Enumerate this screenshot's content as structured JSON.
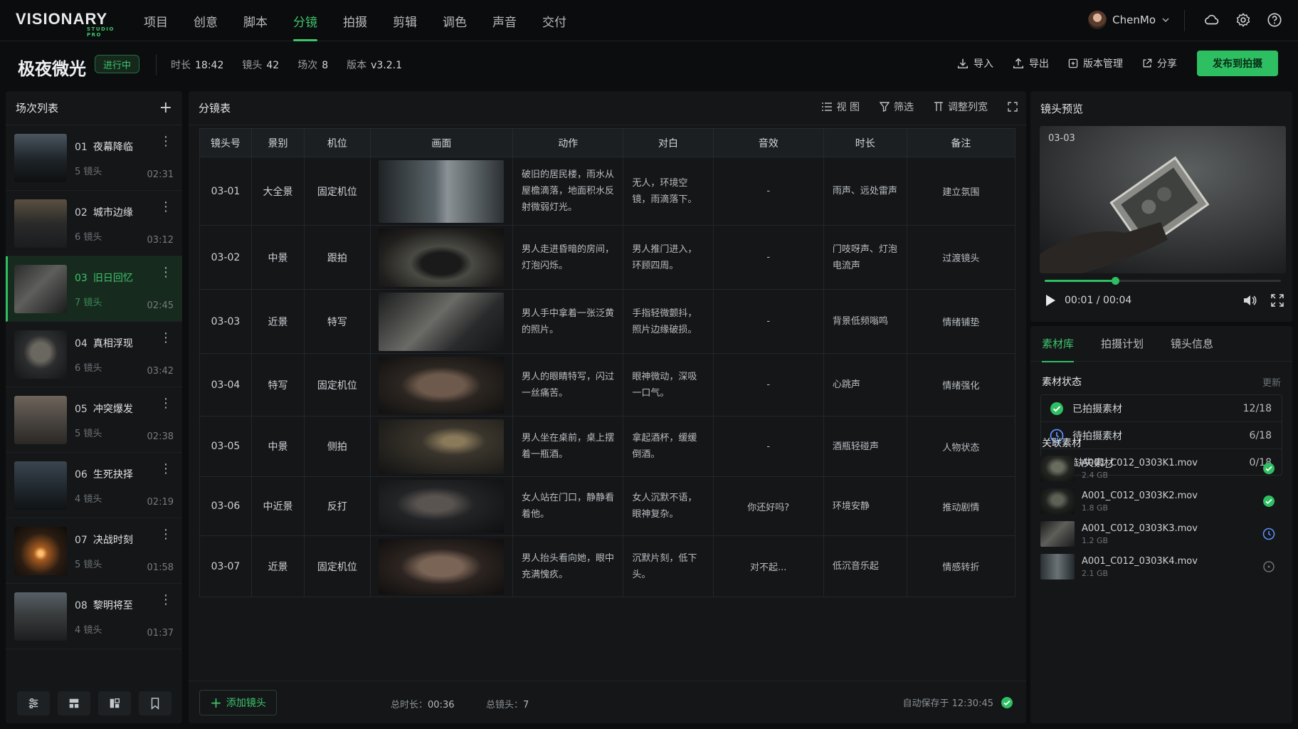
{
  "brand": {
    "name": "VISIONARY",
    "sub": "STUDIO PRO"
  },
  "nav": [
    "项目",
    "创意",
    "脚本",
    "分镜",
    "拍摄",
    "剪辑",
    "调色",
    "声音",
    "交付"
  ],
  "nav_active": 3,
  "user": {
    "name": "ChenMo"
  },
  "project": {
    "title": "极夜微光",
    "status": "进行中",
    "meta": [
      {
        "label": "时长",
        "value": "18:42"
      },
      {
        "label": "镜头",
        "value": "42"
      },
      {
        "label": "场次",
        "value": "8"
      },
      {
        "label": "版本",
        "value": "v3.2.1"
      }
    ],
    "actions": {
      "import": "导入",
      "export": "导出",
      "versions": "版本管理",
      "share": "分享",
      "publish": "发布到拍摄"
    }
  },
  "scenes": {
    "title": "场次列表",
    "items": [
      {
        "num": "01",
        "name": "夜幕降临",
        "shots": "5  镜头",
        "dur": "02:31"
      },
      {
        "num": "02",
        "name": "城市边缘",
        "shots": "6  镜头",
        "dur": "03:12"
      },
      {
        "num": "03",
        "name": "旧日回忆",
        "shots": "7  镜头",
        "dur": "02:45"
      },
      {
        "num": "04",
        "name": "真相浮现",
        "shots": "6  镜头",
        "dur": "03:42"
      },
      {
        "num": "05",
        "name": "冲突爆发",
        "shots": "5  镜头",
        "dur": "02:38"
      },
      {
        "num": "06",
        "name": "生死抉择",
        "shots": "4  镜头",
        "dur": "02:19"
      },
      {
        "num": "07",
        "name": "决战时刻",
        "shots": "5  镜头",
        "dur": "01:58"
      },
      {
        "num": "08",
        "name": "黎明将至",
        "shots": "4  镜头",
        "dur": "01:37"
      }
    ],
    "active": 2
  },
  "board": {
    "title": "分镜表",
    "tools": {
      "view": "视 图",
      "filter": "筛选",
      "columns": "调整列宽"
    },
    "columns": [
      "镜头号",
      "景别",
      "机位",
      "画面",
      "动作",
      "对白",
      "音效",
      "时长",
      "备注"
    ],
    "rows": [
      {
        "id": "03-01",
        "shot": "大全景",
        "cam": "固定机位",
        "action": "破旧的居民楼，雨水从屋檐滴落，地面积水反射微弱灯光。",
        "dialog": "无人，环境空镜，雨滴落下。",
        "line": "-",
        "sound": "雨声、远处雷声",
        "note": "建立氛围"
      },
      {
        "id": "03-02",
        "shot": "中景",
        "cam": "跟拍",
        "action": "男人走进昏暗的房间，灯泡闪烁。",
        "dialog": "男人推门进入，环顾四周。",
        "line": "-",
        "sound": "门吱呀声、灯泡电流声",
        "note": "过渡镜头"
      },
      {
        "id": "03-03",
        "shot": "近景",
        "cam": "特写",
        "action": "男人手中拿着一张泛黄的照片。",
        "dialog": "手指轻微颤抖，照片边缘破损。",
        "line": "-",
        "sound": "背景低频嗡鸣",
        "note": "情绪铺垫"
      },
      {
        "id": "03-04",
        "shot": "特写",
        "cam": "固定机位",
        "action": "男人的眼睛特写，闪过一丝痛苦。",
        "dialog": "眼神微动，深吸一口气。",
        "line": "-",
        "sound": "心跳声",
        "note": "情绪强化"
      },
      {
        "id": "03-05",
        "shot": "中景",
        "cam": "侧拍",
        "action": "男人坐在桌前，桌上摆着一瓶酒。",
        "dialog": "拿起酒杯，缓缓倒酒。",
        "line": "-",
        "sound": "酒瓶轻碰声",
        "note": "人物状态"
      },
      {
        "id": "03-06",
        "shot": "中近景",
        "cam": "反打",
        "action": "女人站在门口，静静看着他。",
        "dialog": "女人沉默不语，眼神复杂。",
        "line": "你还好吗?",
        "sound": "环境安静",
        "note": "推动剧情"
      },
      {
        "id": "03-07",
        "shot": "近景",
        "cam": "固定机位",
        "action": "男人抬头看向她，眼中充满愧疚。",
        "dialog": "沉默片刻，低下头。",
        "line": "对不起...",
        "sound": "低沉音乐起",
        "note": "情感转折"
      }
    ],
    "footer": {
      "add": "添加镜头",
      "total_dur_label": "总时长：",
      "total_dur": "00:36",
      "total_shots_label": "总镜头：",
      "total_shots": "7",
      "saved": "自动保存于 12:30:45"
    }
  },
  "preview": {
    "title": "镜头预览",
    "shot": "03-03",
    "time": "00:01 / 00:04",
    "progress": 0.3
  },
  "assets": {
    "tabs": [
      "素材库",
      "拍摄计划",
      "镜头信息"
    ],
    "status_title": "素材状态",
    "refresh": "更新",
    "status": [
      {
        "label": "已拍摄素材",
        "count": "12/18",
        "color": "#2fbf63"
      },
      {
        "label": "待拍摄素材",
        "count": "6/18",
        "color": "#5b8ff9"
      },
      {
        "label": "缺失素材",
        "count": "0/18",
        "color": "#e5484d"
      }
    ],
    "related_title": "关联素材",
    "files": [
      {
        "name": "A001_C012_0303K1.mov",
        "size": "2.4 GB",
        "state": "done"
      },
      {
        "name": "A001_C012_0303K2.mov",
        "size": "1.8 GB",
        "state": "done"
      },
      {
        "name": "A001_C012_0303K3.mov",
        "size": "1.2 GB",
        "state": "pending"
      },
      {
        "name": "A001_C012_0303K4.mov",
        "size": "2.1 GB",
        "state": "none"
      }
    ]
  }
}
